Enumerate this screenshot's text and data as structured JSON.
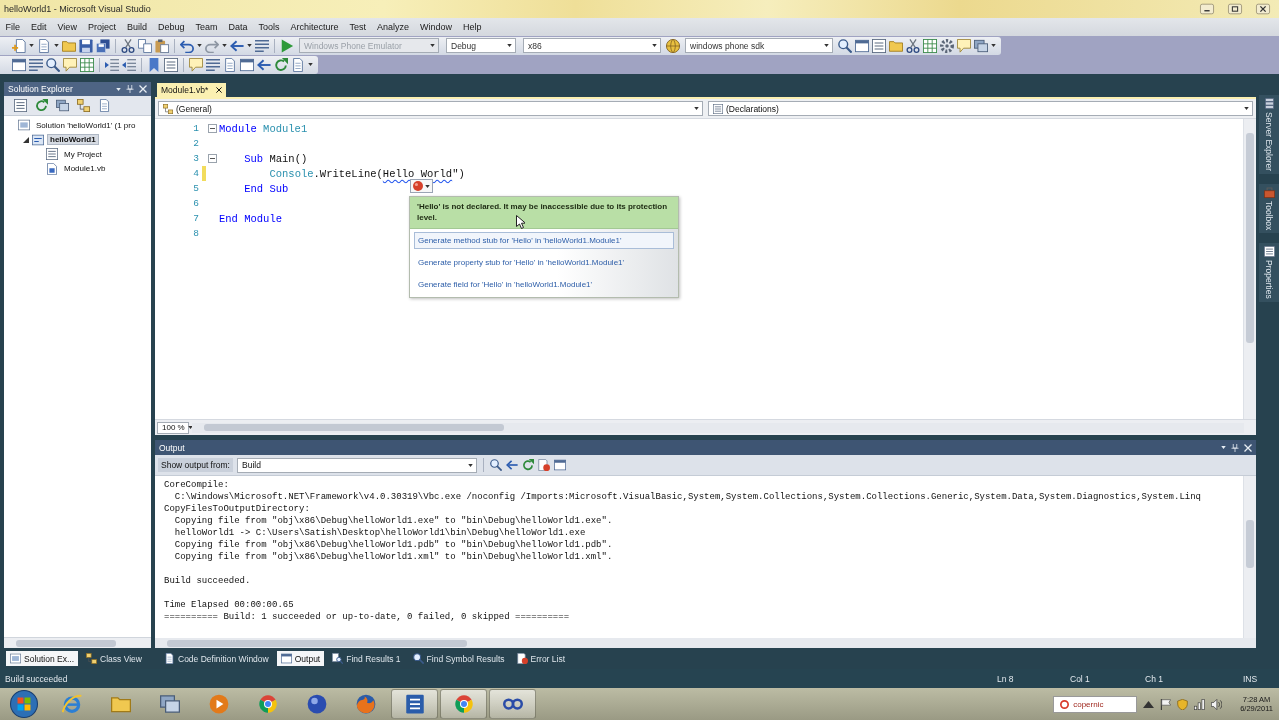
{
  "window": {
    "title": "helloWorld1 - Microsoft Visual Studio"
  },
  "menu": [
    "File",
    "Edit",
    "View",
    "Project",
    "Build",
    "Debug",
    "Team",
    "Data",
    "Tools",
    "Architecture",
    "Test",
    "Analyze",
    "Window",
    "Help"
  ],
  "toolbar": {
    "combos": [
      {
        "value": "Windows Phone Emulator",
        "disabled": true
      },
      {
        "value": "Debug",
        "disabled": false
      },
      {
        "value": "x86",
        "disabled": false
      },
      {
        "value": "windows phone sdk",
        "disabled": false
      }
    ]
  },
  "solution_explorer": {
    "title": "Solution Explorer",
    "tree": [
      {
        "kind": "solution",
        "label": "Solution 'helloWorld1' (1 pro",
        "selected": false,
        "children": [
          {
            "kind": "project",
            "label": "helloWorld1",
            "selected": true,
            "expanded": true,
            "children": [
              {
                "kind": "properties",
                "label": "My Project",
                "selected": false
              },
              {
                "kind": "file",
                "label": "Module1.vb",
                "selected": false
              }
            ]
          }
        ]
      }
    ]
  },
  "editor": {
    "tabs": [
      {
        "label": "Module1.vb*",
        "selected": true
      }
    ],
    "type_dropdown": "(General)",
    "member_dropdown": "(Declarations)",
    "lines": [
      {
        "number": "1",
        "fold": true,
        "modified": false,
        "tokens": [
          {
            "text": "Module",
            "kind": "keyword"
          },
          {
            "text": " Module1",
            "kind": "type"
          }
        ]
      },
      {
        "number": "2",
        "fold": false,
        "modified": false
      },
      {
        "number": "3",
        "fold": true,
        "modified": false,
        "tokens": [
          {
            "text": "    Sub",
            "kind": "keyword"
          },
          {
            "text": " Main()",
            "kind": "plain"
          }
        ]
      },
      {
        "number": "4",
        "fold": false,
        "modified": true,
        "tokens": [
          {
            "text": "        Console",
            "kind": "type"
          },
          {
            "text": ".WriteLine(",
            "kind": "plain"
          },
          {
            "text": "Hello World",
            "kind": "error"
          },
          {
            "text": "\")",
            "kind": "plain"
          }
        ]
      },
      {
        "number": "5",
        "fold": false,
        "modified": false,
        "tokens": [
          {
            "text": "    End Sub",
            "kind": "keyword"
          }
        ]
      },
      {
        "number": "6",
        "fold": false,
        "modified": false
      },
      {
        "number": "7",
        "fold": false,
        "modified": false,
        "tokens": [
          {
            "text": "End Module",
            "kind": "keyword"
          }
        ]
      },
      {
        "number": "8",
        "fold": false,
        "modified": false
      }
    ],
    "zoom": "100 %",
    "smart_tag": {
      "message": "'Hello' is not declared. It may be inaccessible due to its protection level.",
      "options": [
        {
          "label": "Generate method stub for 'Hello' in 'helloWorld1.Module1'",
          "selected": true
        },
        {
          "label": "Generate property stub for 'Hello' in 'helloWorld1.Module1'",
          "selected": false
        },
        {
          "label": "Generate field for 'Hello' in 'helloWorld1.Module1'",
          "selected": false
        }
      ]
    }
  },
  "output": {
    "title": "Output",
    "source_label": "Show output from:",
    "source": "Build",
    "blocks": [
      [
        "CoreCompile:",
        "  C:\\Windows\\Microsoft.NET\\Framework\\v4.0.30319\\Vbc.exe /noconfig /Imports:Microsoft.VisualBasic,System,System.Collections,System.Collections.Generic,System.Data,System.Diagnostics,System.Linq",
        "CopyFilesToOutputDirectory:",
        "  Copying file from \"obj\\x86\\Debug\\helloWorld1.exe\" to \"bin\\Debug\\helloWorld1.exe\".",
        "  helloWorld1 -> C:\\Users\\Satish\\Desktop\\helloWorld1\\bin\\Debug\\helloWorld1.exe",
        "  Copying file from \"obj\\x86\\Debug\\helloWorld1.pdb\" to \"bin\\Debug\\helloWorld1.pdb\".",
        "  Copying file from \"obj\\x86\\Debug\\helloWorld1.xml\" to \"bin\\Debug\\helloWorld1.xml\"."
      ],
      [
        "Build succeeded."
      ],
      [
        "Time Elapsed 00:00:00.65",
        "========== Build: 1 succeeded or up-to-date, 0 failed, 0 skipped =========="
      ]
    ]
  },
  "side_tabs": [
    "Server Explorer",
    "Toolbox",
    "Properties"
  ],
  "bottom_tabs": {
    "left": [
      {
        "label": "Solution Ex...",
        "selected": true
      },
      {
        "label": "Class View",
        "selected": false
      }
    ],
    "right": [
      {
        "label": "Code Definition Window",
        "selected": false
      },
      {
        "label": "Output",
        "selected": true
      },
      {
        "label": "Find Results 1",
        "selected": false
      },
      {
        "label": "Find Symbol Results",
        "selected": false
      },
      {
        "label": "Error List",
        "selected": false
      }
    ]
  },
  "status_bar": {
    "message": "Build succeeded",
    "line": "Ln 8",
    "column": "Col 1",
    "char": "Ch 1",
    "mode": "INS"
  },
  "taskbar": {
    "buttons": [
      {
        "running": false
      },
      {
        "running": false
      },
      {
        "running": false
      },
      {
        "running": false
      },
      {
        "running": false
      },
      {
        "running": false
      },
      {
        "running": false
      },
      {
        "running": true
      },
      {
        "running": true
      },
      {
        "running": true
      }
    ],
    "search": "copernic",
    "time": "7:28 AM",
    "date": "6/29/2011"
  }
}
